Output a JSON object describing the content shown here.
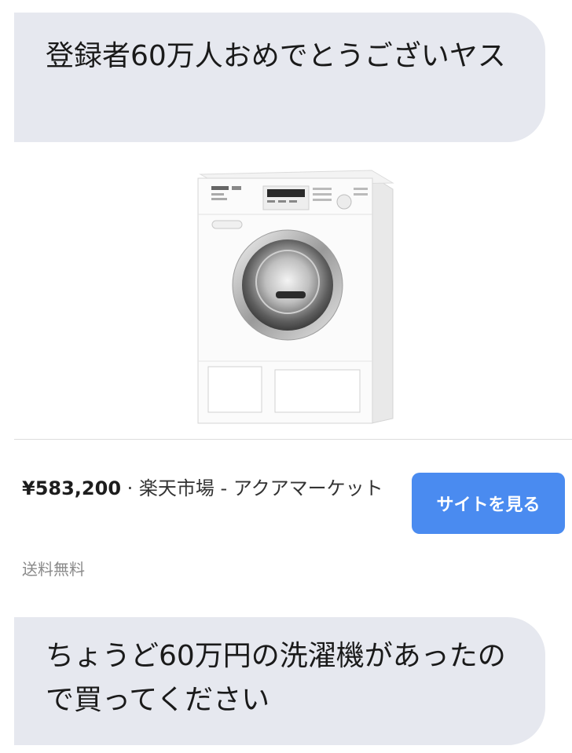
{
  "messages": {
    "top": "登録者60万人おめでとうございヤス",
    "bottom": "ちょうど60万円の洗濯機があったので買ってください"
  },
  "product": {
    "image_icon": "washing-machine-icon",
    "price": "¥583,200",
    "separator": " · ",
    "seller": "楽天市場 - アクアマーケット",
    "shipping": "送料無料",
    "button_label": "サイトを見る"
  },
  "colors": {
    "bubble": "#e6e8ef",
    "button": "#4a8bf0"
  }
}
